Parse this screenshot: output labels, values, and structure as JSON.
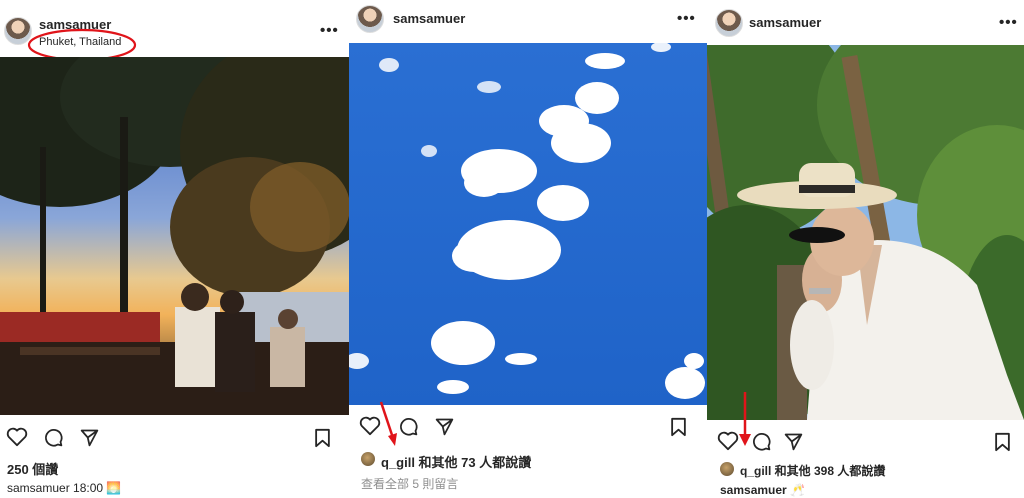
{
  "posts": [
    {
      "username": "samsamuer",
      "location": "Phuket, Thailand",
      "likes": "250 個讚",
      "caption_user": "samsamuer",
      "caption_text": "18:00 🌅"
    },
    {
      "username": "samsamuer",
      "liked_by": "q_gill 和其他 73 人都說讚",
      "view_comments": "查看全部 5 則留言"
    },
    {
      "username": "samsamuer",
      "liked_by": "q_gill 和其他 398 人都說讚",
      "caption_user": "samsamuer",
      "caption_text": "🥂"
    }
  ],
  "icons": [
    "heart-icon",
    "comment-icon",
    "share-icon",
    "bookmark-icon",
    "more-icon"
  ],
  "colors": {
    "annotation": "#e0141a",
    "sky": "#1f6fd6"
  }
}
